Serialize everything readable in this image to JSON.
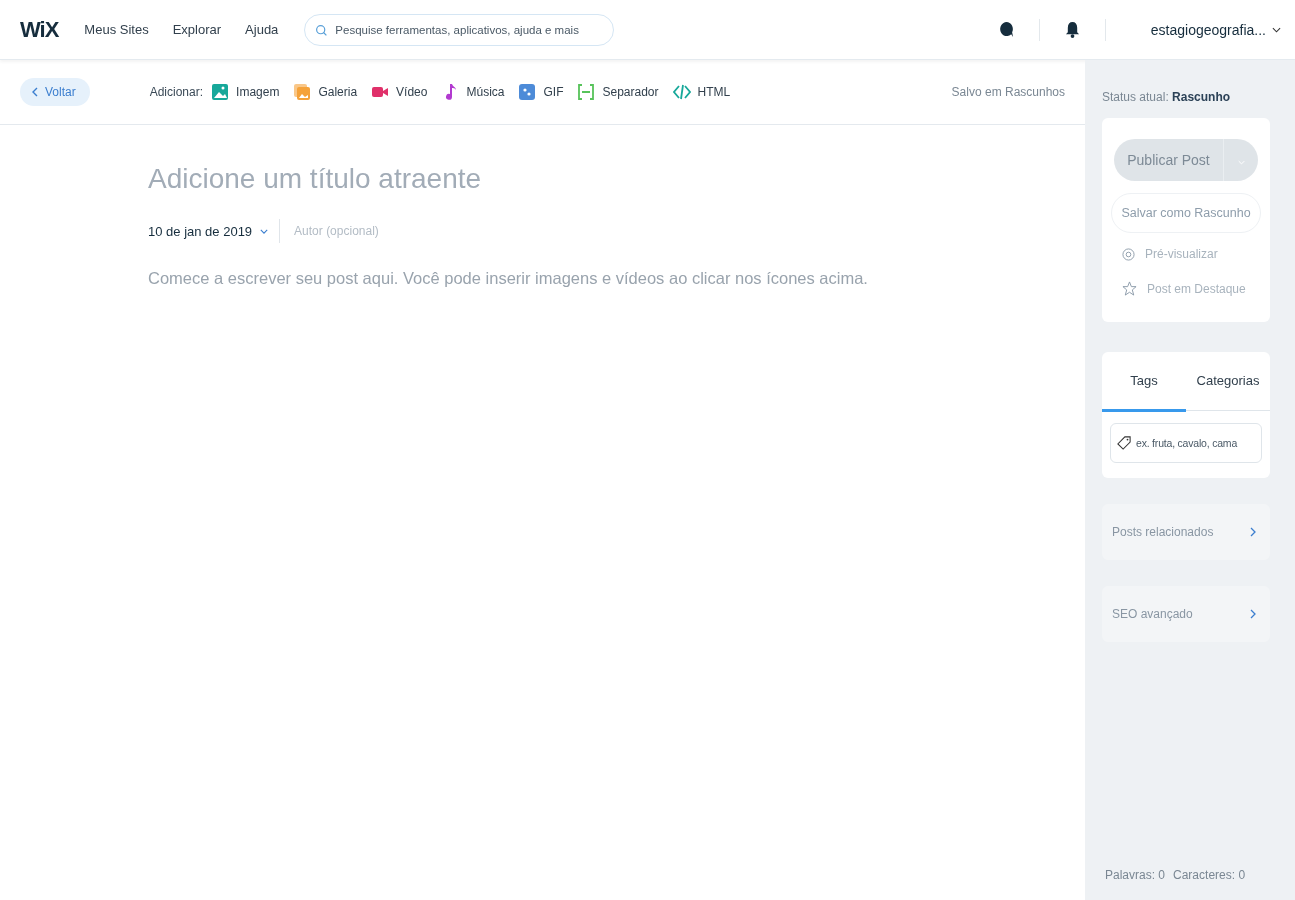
{
  "top_bar": {
    "logo": "WiX",
    "nav": [
      "Meus Sites",
      "Explorar",
      "Ajuda"
    ],
    "search": {
      "placeholder": "Pesquise ferramentas, aplicativos, ajuda e mais"
    },
    "account": "estagiogeografia..."
  },
  "toolbar": {
    "back": "Voltar",
    "add_label": "Adicionar:",
    "items": [
      {
        "kind": "image",
        "label": "Imagem",
        "color": "#17a89a"
      },
      {
        "kind": "gallery",
        "label": "Galeria",
        "color": "#f5a23a"
      },
      {
        "kind": "video",
        "label": "Vídeo",
        "color": "#e0306a"
      },
      {
        "kind": "music",
        "label": "Música",
        "color": "#b23ad0"
      },
      {
        "kind": "gif",
        "label": "GIF",
        "color": "#4d8bd8"
      },
      {
        "kind": "divider",
        "label": "Separador",
        "color": "#57c35a"
      },
      {
        "kind": "html",
        "label": "HTML",
        "color": "#17a89a"
      }
    ],
    "save_status": "Salvo em Rascunhos"
  },
  "editor": {
    "title_placeholder": "Adicione um título atraente",
    "date": "10 de jan de 2019",
    "author_placeholder": "Autor (opcional)",
    "body_placeholder": "Comece a escrever seu post aqui. Você pode inserir imagens e vídeos ao clicar nos ícones acima."
  },
  "sidebar": {
    "status_label": "Status atual:",
    "status": "Rascunho",
    "publish": {
      "label": "Publicar Post",
      "disabled": true
    },
    "save_draft": {
      "label": "Salvar como Rascunho",
      "disabled": true
    },
    "actions": [
      {
        "kind": "preview",
        "label": "Pré-visualizar"
      },
      {
        "kind": "featured",
        "label": "Post em Destaque"
      }
    ],
    "tabs": [
      {
        "label": "Tags",
        "selected": true
      },
      {
        "label": "Categorias",
        "selected": false
      }
    ],
    "tag_field": {
      "placeholder": "ex. fruta, cavalo, cama"
    },
    "sections": [
      "Posts relacionados",
      "SEO avançado"
    ],
    "counts": [
      "Palavras: 0",
      "Caracteres: 0"
    ]
  }
}
